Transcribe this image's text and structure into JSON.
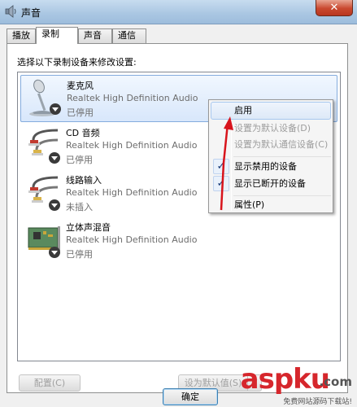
{
  "window": {
    "title": "声音",
    "close_label": "✕"
  },
  "tabs": [
    {
      "label": "播放",
      "active": false
    },
    {
      "label": "录制",
      "active": true
    },
    {
      "label": "声音",
      "active": false
    },
    {
      "label": "通信",
      "active": false
    }
  ],
  "instruction": "选择以下录制设备来修改设置:",
  "devices": [
    {
      "name": "麦克风",
      "driver": "Realtek High Definition Audio",
      "status": "已停用",
      "icon": "microphone-icon",
      "selected": true
    },
    {
      "name": "CD 音频",
      "driver": "Realtek High Definition Audio",
      "status": "已停用",
      "icon": "rca-cable-icon",
      "selected": false
    },
    {
      "name": "线路输入",
      "driver": "Realtek High Definition Audio",
      "status": "未插入",
      "icon": "rca-cable-icon",
      "selected": false
    },
    {
      "name": "立体声混音",
      "driver": "Realtek High Definition Audio",
      "status": "已停用",
      "icon": "sound-card-icon",
      "selected": false
    }
  ],
  "context_menu": {
    "items": [
      {
        "label": "启用",
        "enabled": true,
        "hot": true,
        "checked": false
      },
      {
        "label": "设置为默认设备(D)",
        "enabled": false,
        "checked": false
      },
      {
        "label": "设置为默认通信设备(C)",
        "enabled": false,
        "checked": false
      },
      {
        "label": "显示禁用的设备",
        "enabled": true,
        "checked": true
      },
      {
        "label": "显示已断开的设备",
        "enabled": true,
        "checked": true
      },
      {
        "label": "属性(P)",
        "enabled": true,
        "checked": false
      }
    ]
  },
  "buttons": {
    "configure": "配置(C)",
    "set_default": "设为默认值(S)",
    "ok": "确定"
  },
  "watermark": {
    "brand": "aspku",
    "domain": ".com",
    "tagline": "免费网站源码下载站!"
  },
  "colors": {
    "accent_red": "#d6262c",
    "selection": "#d8e7fb",
    "status_arrow": "#2c2c2c"
  }
}
